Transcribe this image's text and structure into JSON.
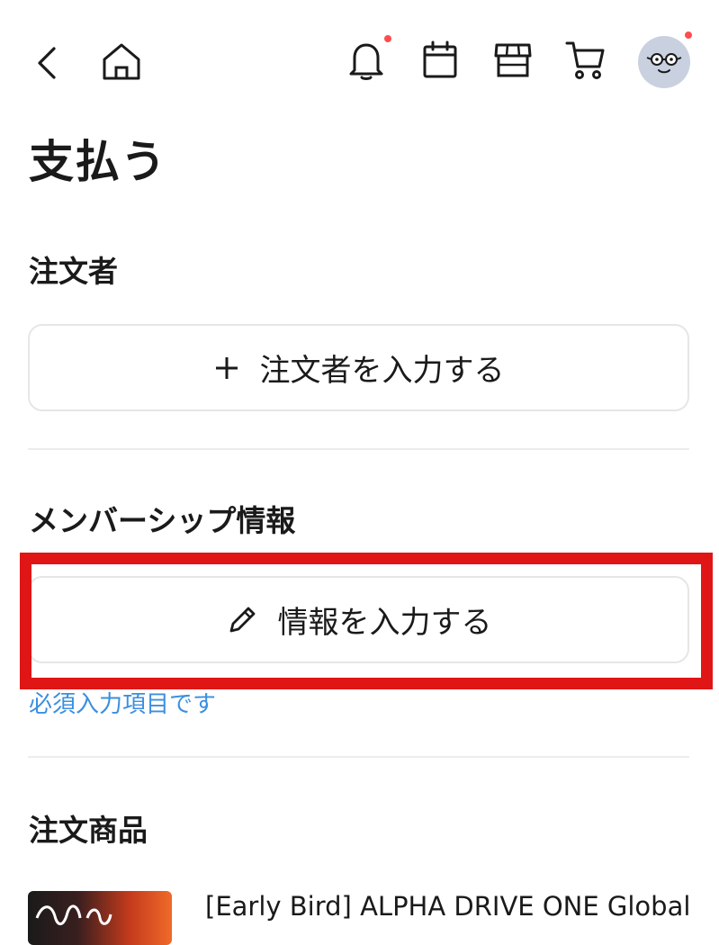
{
  "header": {
    "icons": [
      "back-icon",
      "home-icon",
      "bell-icon",
      "calendar-icon",
      "store-icon",
      "cart-icon",
      "avatar"
    ],
    "notification_dot_color": "#ff4d4d"
  },
  "page": {
    "title": "支払う"
  },
  "orderer": {
    "section_title": "注文者",
    "button_label": "注文者を入力する"
  },
  "membership": {
    "section_title": "メンバーシップ情報",
    "button_label": "情報を入力する",
    "required_note": "必須入力項目です",
    "highlight_color": "#e01515"
  },
  "items": {
    "section_title": "注文商品",
    "products": [
      {
        "name": "[Early Bird] ALPHA DRIVE ONE Global"
      }
    ]
  },
  "colors": {
    "link": "#3b8fe0",
    "border": "#e6e6e6"
  }
}
